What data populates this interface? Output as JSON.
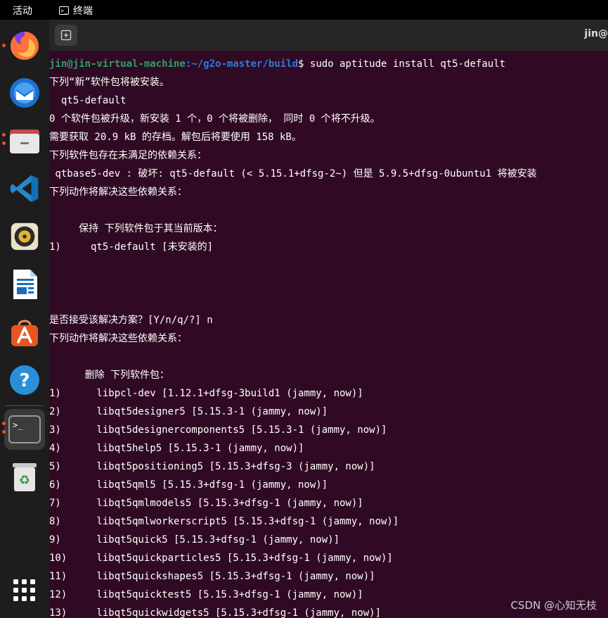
{
  "topbar": {
    "activities": "活动",
    "app_name": "终端"
  },
  "dock": {
    "items": [
      {
        "name": "firefox"
      },
      {
        "name": "thunderbird"
      },
      {
        "name": "files"
      },
      {
        "name": "vscode"
      },
      {
        "name": "rhythmbox"
      },
      {
        "name": "libreoffice-writer"
      },
      {
        "name": "app-center"
      },
      {
        "name": "help"
      },
      {
        "name": "terminal"
      },
      {
        "name": "trash"
      },
      {
        "name": "show-apps"
      }
    ]
  },
  "terminal": {
    "title": "jin@",
    "prompt": {
      "user_host": "jin@jin-virtual-machine",
      "path": ":~/g2o-master/build",
      "symbol": "$",
      "command": " sudo aptitude install qt5-default"
    },
    "lines": [
      "下列“新”软件包将被安装。",
      "  qt5-default",
      "0 个软件包被升级，新安装 1 个，0 个将被删除， 同时 0 个将不升级。",
      "需要获取 20.9 kB 的存档。解包后将要使用 158 kB。",
      "下列软件包存在未满足的依赖关系：",
      " qtbase5-dev : 破坏: qt5-default (< 5.15.1+dfsg-2~) 但是 5.9.5+dfsg-0ubuntu1 将被安装",
      "下列动作将解决这些依赖关系：",
      "",
      "     保持 下列软件包于其当前版本：",
      "1)     qt5-default [未安装的]",
      "",
      "",
      "",
      "是否接受该解决方案？[Y/n/q/?] n",
      "下列动作将解决这些依赖关系：",
      "",
      "      删除 下列软件包：",
      "1)      libpcl-dev [1.12.1+dfsg-3build1 (jammy, now)]",
      "2)      libqt5designer5 [5.15.3-1 (jammy, now)]",
      "3)      libqt5designercomponents5 [5.15.3-1 (jammy, now)]",
      "4)      libqt5help5 [5.15.3-1 (jammy, now)]",
      "5)      libqt5positioning5 [5.15.3+dfsg-3 (jammy, now)]",
      "6)      libqt5qml5 [5.15.3+dfsg-1 (jammy, now)]",
      "7)      libqt5qmlmodels5 [5.15.3+dfsg-1 (jammy, now)]",
      "8)      libqt5qmlworkerscript5 [5.15.3+dfsg-1 (jammy, now)]",
      "9)      libqt5quick5 [5.15.3+dfsg-1 (jammy, now)]",
      "10)     libqt5quickparticles5 [5.15.3+dfsg-1 (jammy, now)]",
      "11)     libqt5quickshapes5 [5.15.3+dfsg-1 (jammy, now)]",
      "12)     libqt5quicktest5 [5.15.3+dfsg-1 (jammy, now)]",
      "13)     libqt5quickwidgets5 [5.15.3+dfsg-1 (jammy, now)]"
    ]
  },
  "watermark": "CSDN @心知无枝",
  "colors": {
    "terminal_bg": "#300a24",
    "prompt_user": "#26a269",
    "prompt_path": "#2a7bde",
    "accent": "#e95420"
  }
}
